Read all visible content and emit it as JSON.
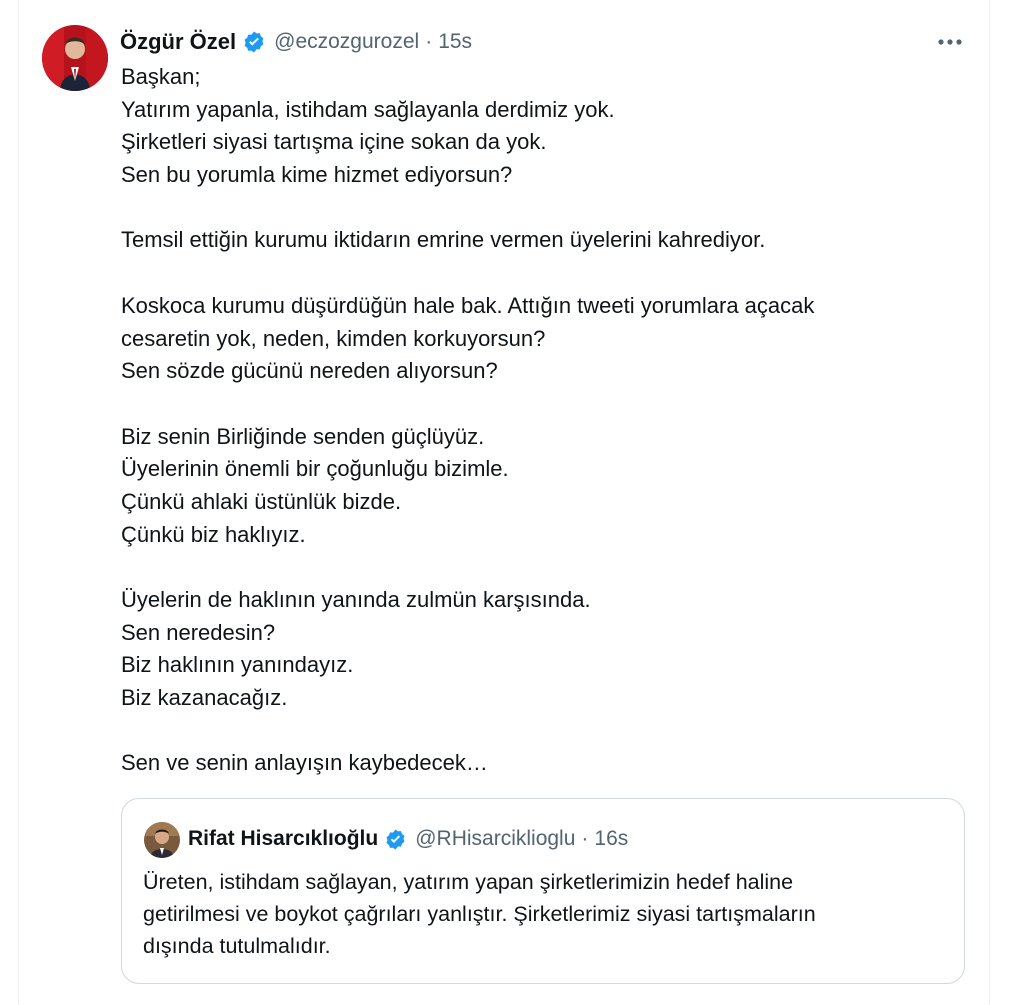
{
  "colors": {
    "text": "#0f1419",
    "secondary": "#536471",
    "verified": "#1d9bf0",
    "border": "#cfd9de"
  },
  "tweet": {
    "author_name": "Özgür Özel",
    "handle": "@eczozgurozel",
    "separator": "·",
    "time": "15s",
    "more_icon": "more-horizontal-icon",
    "lines": [
      "Başkan;",
      "Yatırım yapanla, istihdam sağlayanla derdimiz yok.",
      "Şirketleri siyasi tartışma içine sokan da yok.",
      "Sen bu yorumla kime hizmet ediyorsun?",
      "",
      "Temsil ettiğin kurumu iktidarın emrine vermen üyelerini kahrediyor.",
      "",
      "Koskoca kurumu düşürdüğün hale bak.  Attığın tweeti yorumlara açacak",
      "cesaretin yok, neden, kimden korkuyorsun?",
      "Sen sözde  gücünü nereden alıyorsun?",
      "",
      "Biz senin Birliğinde senden güçlüyüz.",
      "Üyelerinin önemli bir çoğunluğu bizimle.",
      "Çünkü ahlaki üstünlük bizde.",
      "Çünkü biz haklıyız.",
      "",
      "Üyelerin de haklının yanında zulmün karşısında.",
      "Sen neredesin?",
      "Biz haklının yanındayız.",
      "Biz kazanacağız.",
      "",
      "Sen ve senin anlayışın kaybedecek…"
    ]
  },
  "quoted": {
    "author_name": "Rifat Hisarcıklıoğlu",
    "handle": "@RHisarciklioglu",
    "separator": "·",
    "time": "16s",
    "lines": [
      "Üreten, istihdam sağlayan, yatırım yapan şirketlerimizin hedef haline",
      "getirilmesi ve boykot çağrıları yanlıştır. Şirketlerimiz siyasi tartışmaların",
      "dışında tutulmalıdır."
    ]
  }
}
